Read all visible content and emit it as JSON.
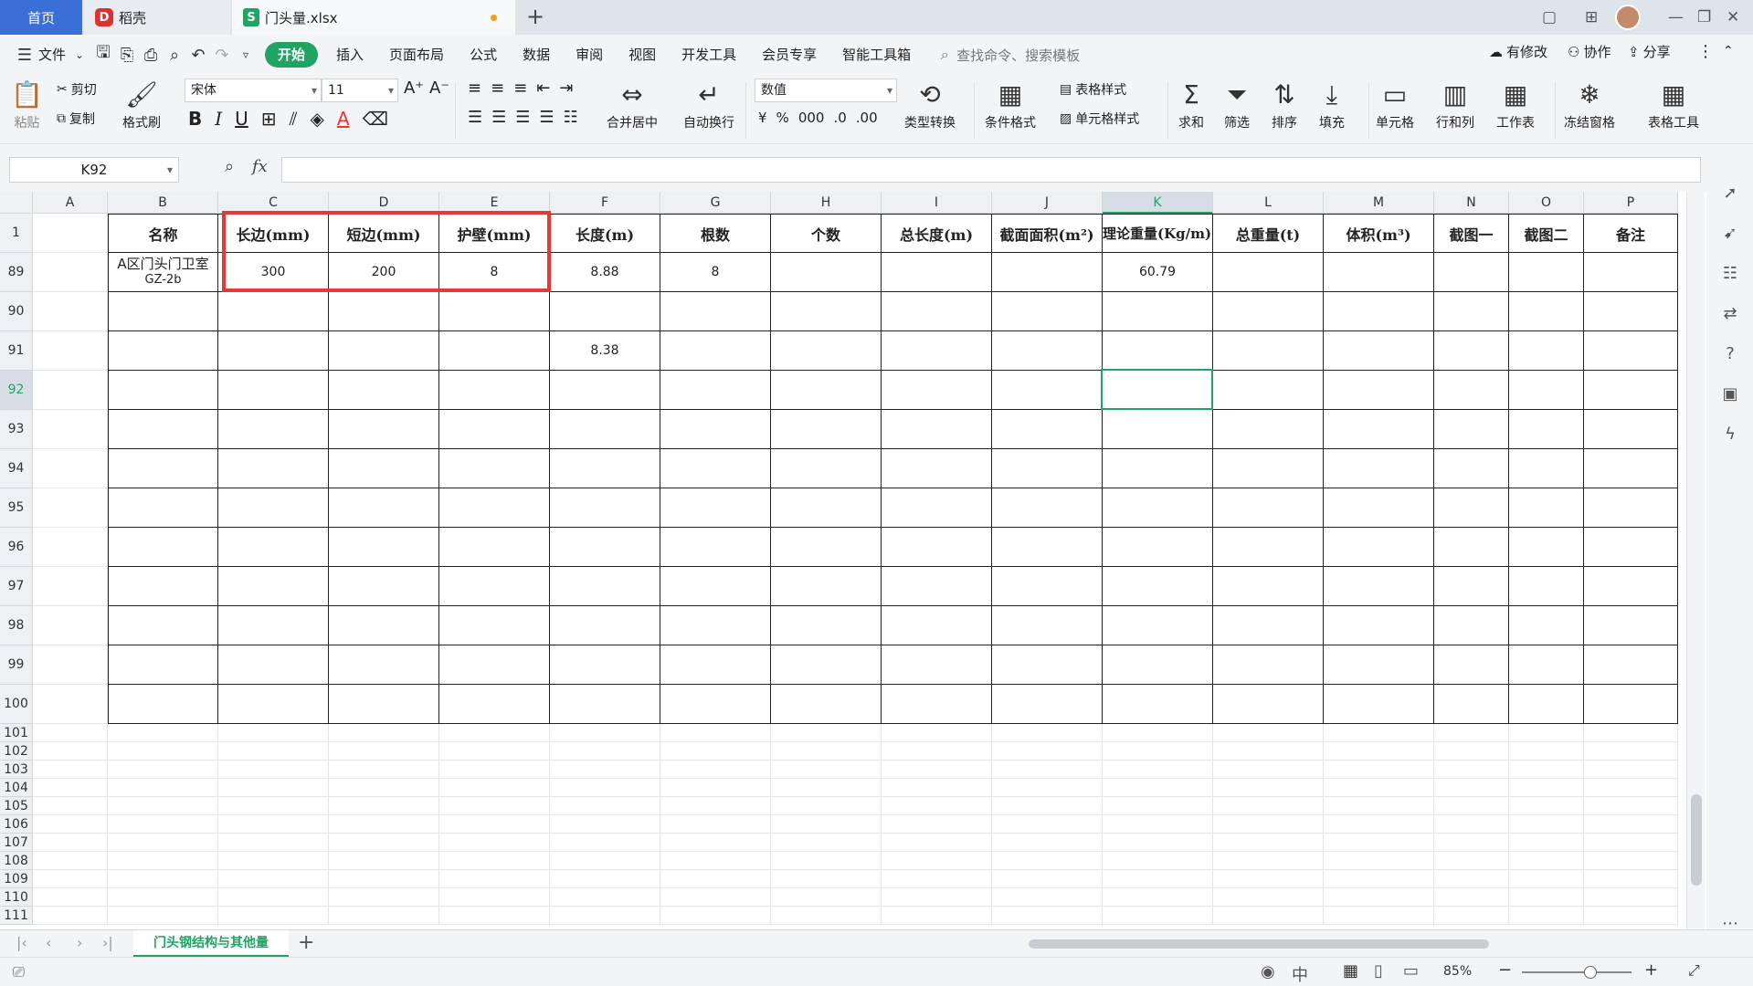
{
  "titlebar": {
    "home_tab": "首页",
    "docer_tab": "稻壳",
    "file_tab": "门头量.xlsx",
    "new_tab": "+"
  },
  "menu": {
    "file": "文件",
    "items": [
      "开始",
      "插入",
      "页面布局",
      "公式",
      "数据",
      "审阅",
      "视图",
      "开发工具",
      "会员专享",
      "智能工具箱"
    ],
    "search_placeholder": "查找命令、搜索模板",
    "modified": "有修改",
    "collab": "协作",
    "share": "分享"
  },
  "ribbon": {
    "paste": "粘贴",
    "cut": "剪切",
    "copy": "复制",
    "format_painter": "格式刷",
    "font_name": "宋体",
    "font_size": "11",
    "merge_center": "合并居中",
    "wrap_text": "自动换行",
    "number_format": "数值",
    "type_convert": "类型转换",
    "cond_format": "条件格式",
    "table_style": "表格样式",
    "cell_style": "单元格样式",
    "sum": "求和",
    "filter": "筛选",
    "sort": "排序",
    "fill": "填充",
    "cell": "单元格",
    "row_col": "行和列",
    "worksheet": "工作表",
    "freeze": "冻结窗格",
    "table_tools": "表格工具"
  },
  "formula": {
    "name_box": "K92",
    "fx": "fx",
    "value": ""
  },
  "columns": [
    "A",
    "B",
    "C",
    "D",
    "E",
    "F",
    "G",
    "H",
    "I",
    "J",
    "K",
    "L",
    "M",
    "N",
    "O",
    "P"
  ],
  "header_row": {
    "row": "1",
    "cells": [
      "",
      "名称",
      "长边(mm)",
      "短边(mm)",
      "护壁(mm)",
      "长度(m)",
      "根数",
      "个数",
      "总长度(m)",
      "截面面积(m²)",
      "理论重量(Kg/m)",
      "总重量(t)",
      "体积(m³)",
      "截图一",
      "截图二",
      "备注"
    ]
  },
  "rows": [
    {
      "row": "89",
      "name_line1": "A区门头门卫室",
      "name_line2": "GZ-2b",
      "C": "300",
      "D": "200",
      "E": "8",
      "F": "8.88",
      "G": "8",
      "K": "60.79"
    },
    {
      "row": "90"
    },
    {
      "row": "91",
      "F": "8.38"
    },
    {
      "row": "92"
    },
    {
      "row": "93"
    },
    {
      "row": "94"
    },
    {
      "row": "95"
    },
    {
      "row": "96"
    },
    {
      "row": "97"
    },
    {
      "row": "98"
    },
    {
      "row": "99"
    },
    {
      "row": "100"
    }
  ],
  "small_rows": [
    "101",
    "102",
    "103",
    "104",
    "105",
    "106",
    "107",
    "108",
    "109",
    "110",
    "111"
  ],
  "sheet_tab": "门头钢结构与其他量",
  "status": {
    "zoom": "85%"
  }
}
